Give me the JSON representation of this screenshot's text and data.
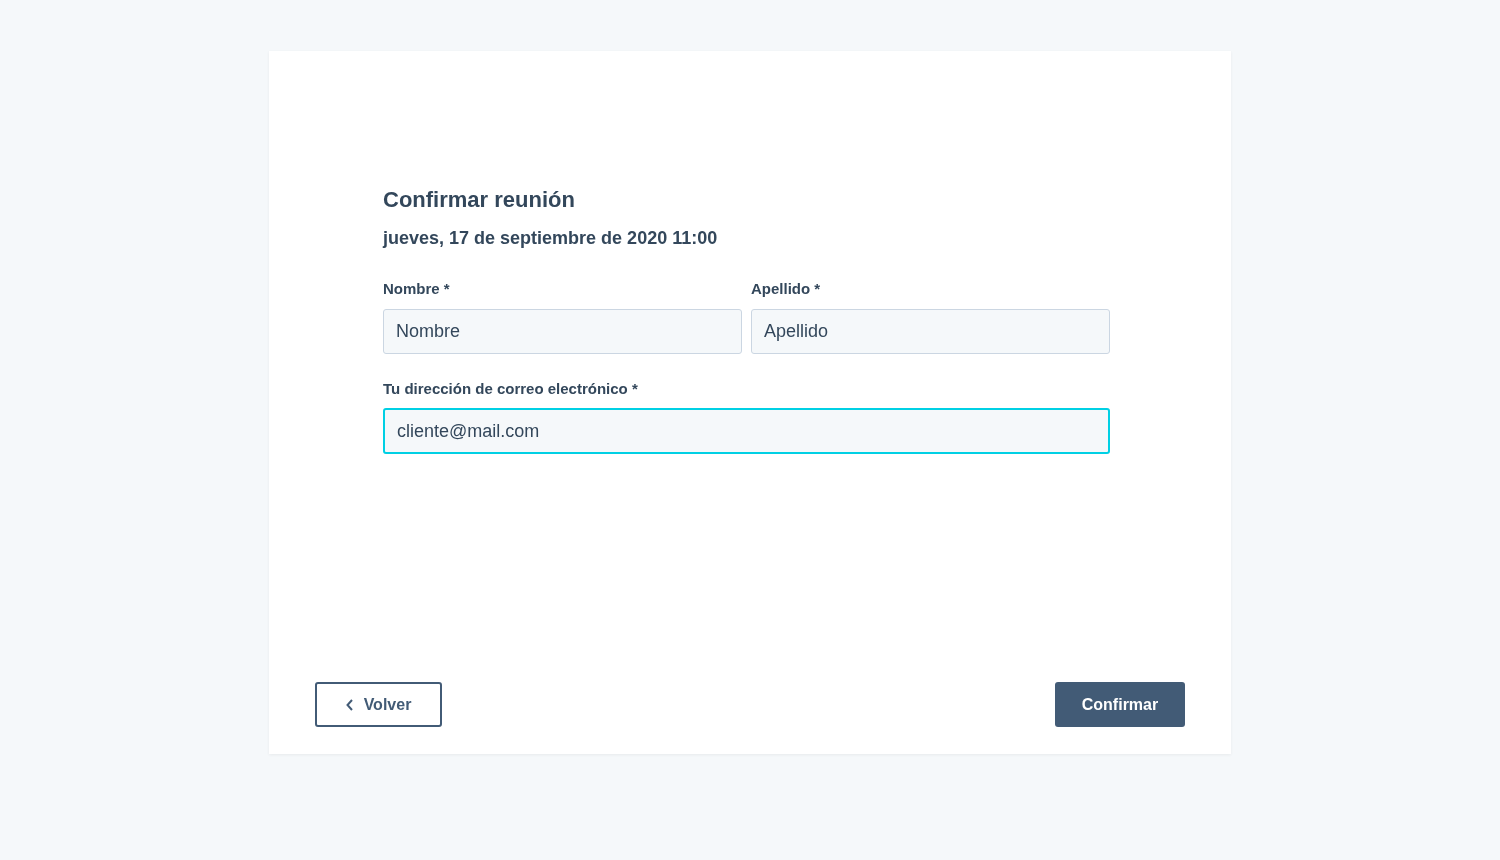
{
  "title": "Confirmar reunión",
  "date": "jueves, 17 de septiembre de 2020 11:00",
  "field_rows": [
    [
      {
        "label": "Nombre *",
        "placeholder": "Nombre",
        "focused": false
      },
      {
        "label": "Apellido *",
        "placeholder": "Apellido",
        "focused": false
      }
    ],
    [
      {
        "label": "Tu dirección de correo electrónico *",
        "value": "cliente@mail.com",
        "focused": true
      }
    ]
  ],
  "back_button": {
    "label": "Volver"
  },
  "confirm_button": {
    "label": "Confirmar"
  }
}
